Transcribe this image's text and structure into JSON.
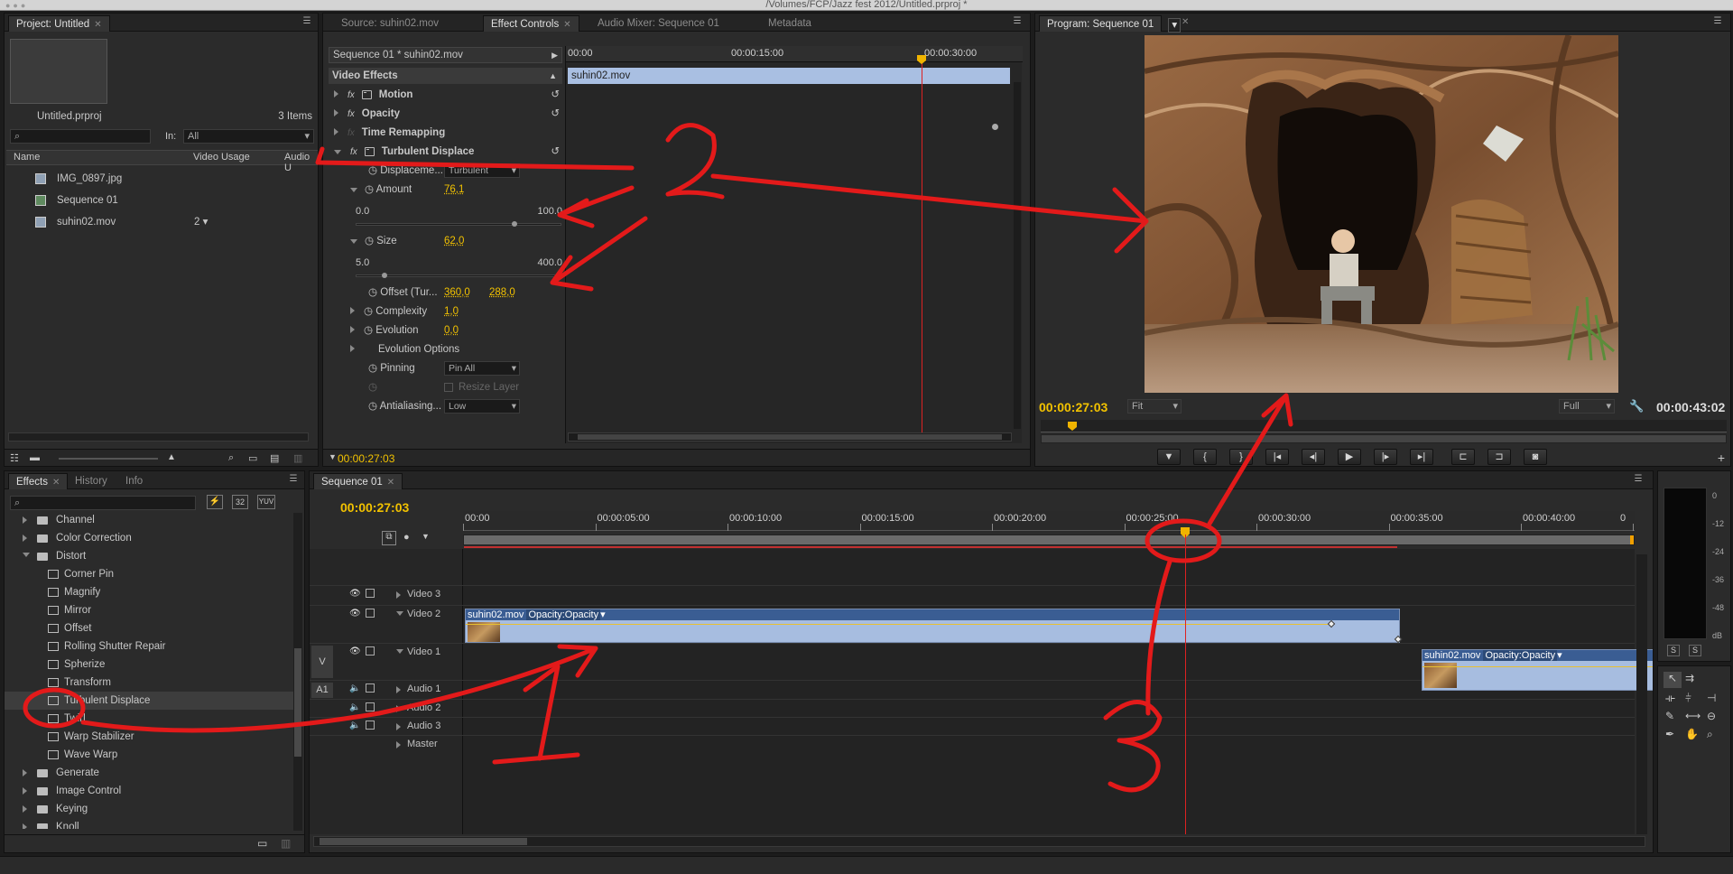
{
  "window": {
    "title": "/Volumes/FCP/Jazz fest 2012/Untitled.prproj *"
  },
  "project": {
    "tab": "Project: Untitled",
    "filename": "Untitled.prproj",
    "items_count": "3 Items",
    "search_placeholder": "",
    "in_label": "In:",
    "in_value": "All",
    "columns": [
      "Name",
      "Video Usage",
      "Audio U"
    ],
    "items": [
      {
        "name": "IMG_0897.jpg",
        "usage": ""
      },
      {
        "name": "Sequence 01",
        "usage": ""
      },
      {
        "name": "suhin02.mov",
        "usage": "2"
      }
    ]
  },
  "source_tabs": [
    "Source: suhin02.mov",
    "Effect Controls",
    "Audio Mixer: Sequence 01",
    "Metadata"
  ],
  "effect_controls": {
    "sequence_label": "Sequence 01 * suhin02.mov",
    "section": "Video Effects",
    "clip_name": "suhin02.mov",
    "ruler": [
      "00:00",
      "00:00:15:00",
      "00:00:30:00"
    ],
    "motion": "Motion",
    "opacity": "Opacity",
    "time_remap": "Time Remapping",
    "turbulent": "Turbulent Displace",
    "displacement_label": "Displaceme...",
    "displacement_value": "Turbulent",
    "amount_label": "Amount",
    "amount_value": "76,1",
    "amount_min": "0.0",
    "amount_max": "100.0",
    "amount_fraction": 0.761,
    "size_label": "Size",
    "size_value": "62,0",
    "size_min": "5.0",
    "size_max": "400.0",
    "offset_label": "Offset (Tur...",
    "offset_x": "360,0",
    "offset_y": "288,0",
    "complexity_label": "Complexity",
    "complexity_value": "1,0",
    "evolution_label": "Evolution",
    "evolution_value": "0,0",
    "evolution_options": "Evolution Options",
    "pinning_label": "Pinning",
    "pinning_value": "Pin All",
    "resize_layer": "Resize Layer",
    "antialias_label": "Antialiasing...",
    "antialias_value": "Low",
    "timecode": "00:00:27:03"
  },
  "program": {
    "tab": "Program: Sequence 01",
    "timecode": "00:00:27:03",
    "fit": "Fit",
    "full": "Full",
    "duration": "00:00:43:02"
  },
  "effects_panel": {
    "tabs": [
      "Effects",
      "History",
      "Info"
    ],
    "bins": [
      "32",
      "YUV"
    ],
    "items": [
      {
        "label": "Channel",
        "type": "folder",
        "level": 1,
        "state": "closed"
      },
      {
        "label": "Color Correction",
        "type": "folder",
        "level": 1,
        "state": "closed"
      },
      {
        "label": "Distort",
        "type": "folder",
        "level": 1,
        "state": "open"
      },
      {
        "label": "Corner Pin",
        "type": "effect",
        "level": 2
      },
      {
        "label": "Magnify",
        "type": "effect",
        "level": 2
      },
      {
        "label": "Mirror",
        "type": "effect",
        "level": 2
      },
      {
        "label": "Offset",
        "type": "effect",
        "level": 2
      },
      {
        "label": "Rolling Shutter Repair",
        "type": "effect",
        "level": 2
      },
      {
        "label": "Spherize",
        "type": "effect",
        "level": 2
      },
      {
        "label": "Transform",
        "type": "effect",
        "level": 2
      },
      {
        "label": "Turbulent Displace",
        "type": "effect",
        "level": 2,
        "selected": true
      },
      {
        "label": "Twirl",
        "type": "effect",
        "level": 2
      },
      {
        "label": "Warp Stabilizer",
        "type": "effect",
        "level": 2
      },
      {
        "label": "Wave Warp",
        "type": "effect",
        "level": 2
      },
      {
        "label": "Generate",
        "type": "folder",
        "level": 1,
        "state": "closed"
      },
      {
        "label": "Image Control",
        "type": "folder",
        "level": 1,
        "state": "closed"
      },
      {
        "label": "Keying",
        "type": "folder",
        "level": 1,
        "state": "closed"
      },
      {
        "label": "Knoll",
        "type": "folder",
        "level": 1,
        "state": "closed"
      }
    ]
  },
  "timeline": {
    "tab": "Sequence 01",
    "timecode": "00:00:27:03",
    "ruler": [
      "00:00",
      "00:00:05:00",
      "00:00:10:00",
      "00:00:15:00",
      "00:00:20:00",
      "00:00:25:00",
      "00:00:30:00",
      "00:00:35:00",
      "00:00:40:00",
      "0"
    ],
    "tracks": [
      {
        "name": "Video 3",
        "patch": ""
      },
      {
        "name": "Video 2",
        "patch": ""
      },
      {
        "name": "Video 1",
        "patch": "V"
      },
      {
        "name": "Audio 1",
        "patch": "A1"
      },
      {
        "name": "Audio 2",
        "patch": ""
      },
      {
        "name": "Audio 3",
        "patch": ""
      },
      {
        "name": "Master",
        "patch": ""
      }
    ],
    "clip_v2_name": "suhin02.mov",
    "clip_v2_fx": "Opacity:Opacity",
    "clip_v1_name": "suhin02.mov",
    "clip_v1_fx": "Opacity:Opacity"
  },
  "meter": {
    "labels": [
      "0",
      "-12",
      "-24",
      "-36",
      "-48",
      "dB"
    ],
    "solo": [
      "S",
      "S"
    ]
  },
  "annotations": {
    "n1": "1",
    "n2": "2",
    "n3": "3",
    "color": "#e31a1a"
  }
}
